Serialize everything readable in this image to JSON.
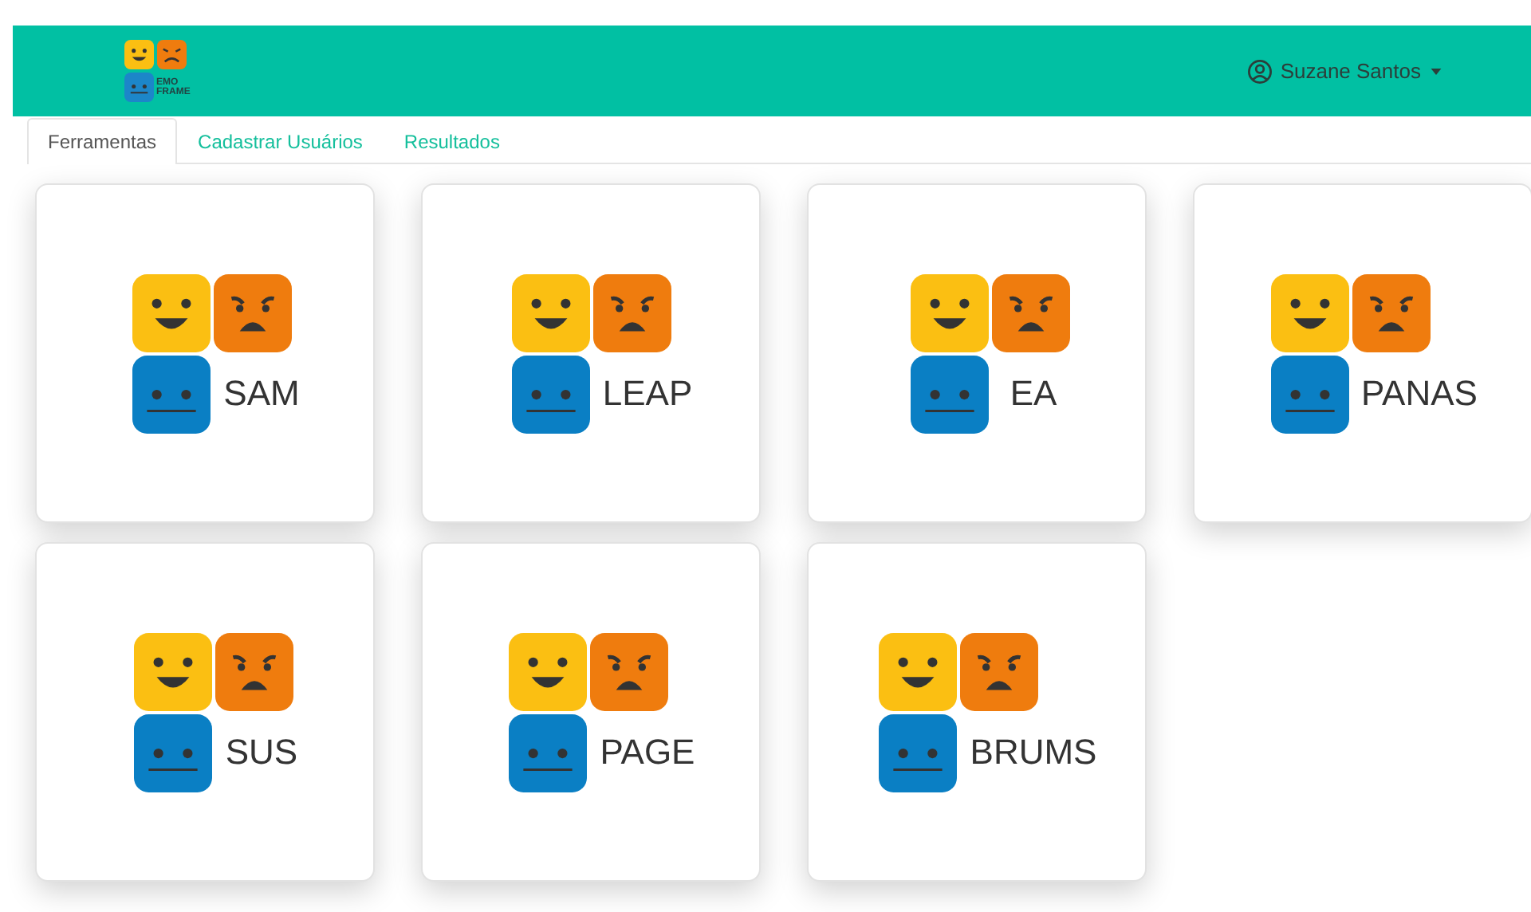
{
  "header": {
    "logo_text": [
      "EMO",
      "FRAME"
    ],
    "user": "Suzane Santos"
  },
  "tabs": [
    {
      "label": "Ferramentas",
      "selected": true
    },
    {
      "label": "Cadastrar Usuários",
      "selected": false
    },
    {
      "label": "Resultados",
      "selected": false
    }
  ],
  "tools": [
    {
      "name": "SAM"
    },
    {
      "name": "LEAP"
    },
    {
      "name": "EA"
    },
    {
      "name": "PANAS"
    },
    {
      "name": "SUS"
    },
    {
      "name": "PAGE"
    },
    {
      "name": "BRUMS"
    }
  ]
}
